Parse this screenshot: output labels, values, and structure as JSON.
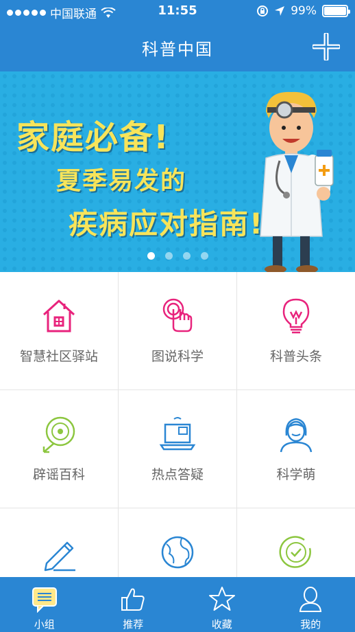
{
  "status_bar": {
    "carrier": "中国联通",
    "time": "11:55",
    "battery": "99%"
  },
  "nav": {
    "title": "科普中国",
    "add_icon": "plus-icon"
  },
  "banner": {
    "line1": "家庭必备!",
    "line2": "夏季易发的",
    "line3": "疾病应对指南!",
    "page_count": 4,
    "active_page": 1
  },
  "grid": {
    "items": [
      {
        "label": "智慧社区驿站",
        "icon": "house-icon",
        "color": "#e8237c"
      },
      {
        "label": "图说科学",
        "icon": "touch-icon",
        "color": "#e8237c"
      },
      {
        "label": "科普头条",
        "icon": "lightbulb-icon",
        "color": "#e8237c"
      },
      {
        "label": "辟谣百科",
        "icon": "disc-icon",
        "color": "#8cc63f"
      },
      {
        "label": "热点答疑",
        "icon": "laptop-icon",
        "color": "#2a86d3"
      },
      {
        "label": "科学萌",
        "icon": "person-icon",
        "color": "#2a86d3"
      },
      {
        "label": "",
        "icon": "pencil-icon",
        "color": "#2a86d3"
      },
      {
        "label": "",
        "icon": "globe-icon",
        "color": "#2a86d3"
      },
      {
        "label": "",
        "icon": "check-circle-icon",
        "color": "#8cc63f"
      }
    ]
  },
  "tabbar": {
    "tabs": [
      {
        "label": "小组",
        "icon": "chat-icon"
      },
      {
        "label": "推荐",
        "icon": "thumbs-up-icon"
      },
      {
        "label": "收藏",
        "icon": "star-icon"
      },
      {
        "label": "我的",
        "icon": "user-icon"
      }
    ]
  },
  "colors": {
    "primary": "#2a86d3",
    "banner_bg": "#29aee3",
    "banner_text": "#f7e45a",
    "magenta": "#e8237c",
    "green": "#8cc63f"
  }
}
